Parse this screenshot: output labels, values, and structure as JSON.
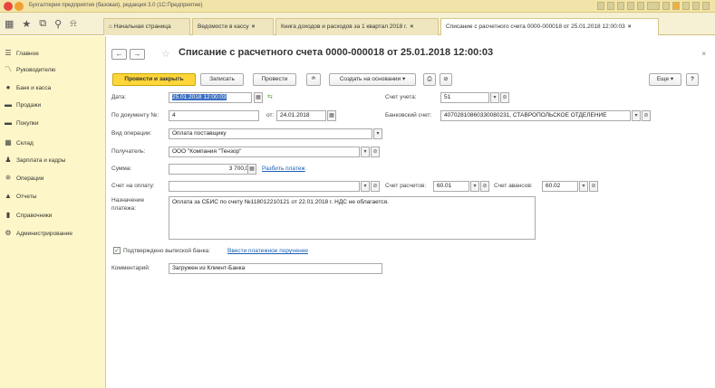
{
  "window": {
    "title": "Бухгалтерия предприятия (базовая), редакция 3.0 (1С:Предприятие)"
  },
  "tabs": [
    {
      "label": "Начальная страница",
      "closable": false
    },
    {
      "label": "Ведомости в кассу",
      "closable": true
    },
    {
      "label": "Книга доходов и расходов за 1 квартал 2018 г.",
      "closable": true
    },
    {
      "label": "Списание с расчетного счета 0000-000018 от 25.01.2018 12:00:03",
      "closable": true
    }
  ],
  "sidebar": {
    "items": [
      {
        "label": "Главное",
        "icon": "☰"
      },
      {
        "label": "Руководителю",
        "icon": "〽"
      },
      {
        "label": "Банк и касса",
        "icon": "●"
      },
      {
        "label": "Продажи",
        "icon": "▬"
      },
      {
        "label": "Покупки",
        "icon": "▬"
      },
      {
        "label": "Склад",
        "icon": "▦"
      },
      {
        "label": "Зарплата и кадры",
        "icon": "♟"
      },
      {
        "label": "Операции",
        "icon": "⁜"
      },
      {
        "label": "Отчеты",
        "icon": "▲"
      },
      {
        "label": "Справочники",
        "icon": "▮"
      },
      {
        "label": "Администрирование",
        "icon": "⚙"
      }
    ]
  },
  "document": {
    "title": "Списание с расчетного счета 0000-000018 от 25.01.2018 12:00:03"
  },
  "toolbar": {
    "post_close": "Провести и закрыть",
    "save": "Записать",
    "post": "Провести",
    "create_based": "Создать на основании",
    "more": "Еще",
    "help": "?"
  },
  "form": {
    "date_label": "Дата:",
    "date_value": "25.01.2018 12:00:03",
    "account_label": "Счет учета:",
    "account_value": "51",
    "doc_no_label": "По документу №:",
    "doc_no_value": "4",
    "doc_date_label": "от:",
    "doc_date_value": "24.01.2018",
    "bank_account_label": "Банковский счет:",
    "bank_account_value": "40702810860330080231, СТАВРОПОЛЬСКОЕ ОТДЕЛЕНИЕ",
    "op_type_label": "Вид операции:",
    "op_type_value": "Оплата поставщику",
    "recipient_label": "Получатель:",
    "recipient_value": "ООО \"Компания \"Тензор\"",
    "sum_label": "Сумма:",
    "sum_value": "3 700,00",
    "split_payment": "Разбить платеж",
    "invoice_label": "Счет на оплату:",
    "invoice_value": "",
    "settle_account_label": "Счет расчетов:",
    "settle_account_value": "60.01",
    "advance_account_label": "Счет авансов:",
    "advance_account_value": "60.02",
    "purpose_label": "Назначение платежа:",
    "purpose_value": "Оплата за СБИС по счету №118012210121 от 22.01.2018 г. НДС не облагается.",
    "confirmed_label": "Подтверждено выпиской банка:",
    "enter_order": "Ввести платежное поручение",
    "comment_label": "Комментарий:",
    "comment_value": "Загружен из Клиент-Банка"
  },
  "colors": {
    "titlebar": "#f2e3a8",
    "sidebar": "#fdf6c8",
    "primary_button": "#ffd639",
    "link": "#1a5fb4"
  }
}
